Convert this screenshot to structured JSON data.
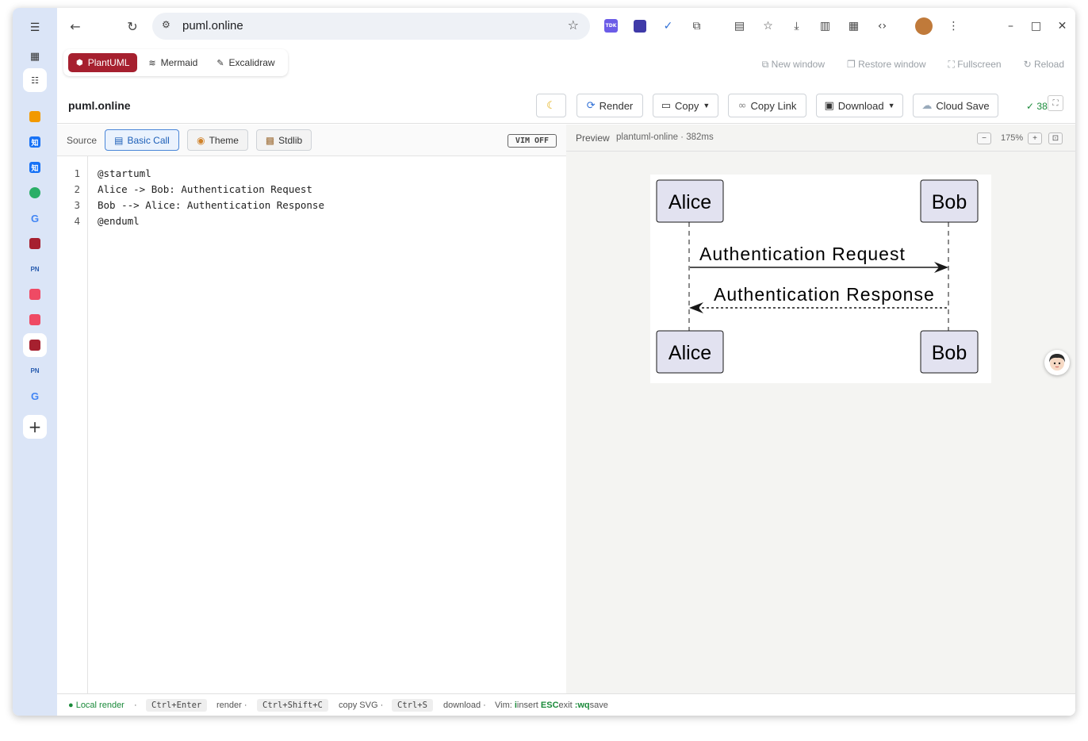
{
  "browser": {
    "url": "puml.online",
    "back_icon": "arrow-left-icon",
    "reload_icon": "reload-icon"
  },
  "modes": [
    {
      "label": "PlantUML",
      "icon": "plantuml-icon",
      "active": true
    },
    {
      "label": "Mermaid",
      "icon": "mermaid-icon",
      "active": false
    },
    {
      "label": "Excalidraw",
      "icon": "edit-icon",
      "active": false
    }
  ],
  "window_controls": {
    "new_window": "New window",
    "restore_window": "Restore window",
    "fullscreen": "Fullscreen",
    "reload": "Reload"
  },
  "header": {
    "title": "puml.online",
    "render": "Render",
    "copy": "Copy",
    "copy_link": "Copy Link",
    "download": "Download",
    "cloud_save": "Cloud Save",
    "status": "✓ 38"
  },
  "source": {
    "label": "Source",
    "basic_call": "Basic Call",
    "theme": "Theme",
    "stdlib": "Stdlib",
    "vim": "VIM OFF"
  },
  "editor": {
    "lines": [
      {
        "n": "1",
        "text": "@startuml"
      },
      {
        "n": "2",
        "text": "Alice -> Bob: Authentication Request"
      },
      {
        "n": "3",
        "text": "Bob --> Alice: Authentication Response"
      },
      {
        "n": "4",
        "text": "@enduml"
      }
    ]
  },
  "preview": {
    "label": "Preview",
    "info": "plantuml-online · 382ms",
    "zoom": "175%",
    "minus": "−",
    "plus": "+"
  },
  "diagram": {
    "participants": [
      "Alice",
      "Bob"
    ],
    "messages": [
      {
        "from": "Alice",
        "to": "Bob",
        "text": "Authentication Request",
        "style": "solid"
      },
      {
        "from": "Bob",
        "to": "Alice",
        "text": "Authentication Response",
        "style": "dashed"
      }
    ]
  },
  "statusbar": {
    "local_render": "● Local render",
    "sep": "·",
    "k1": "Ctrl+Enter",
    "t1": "render ·",
    "k2": "Ctrl+Shift+C",
    "t2": "copy SVG ·",
    "k3": "Ctrl+S",
    "t3": "download ·",
    "vim_prefix": "Vim: ",
    "vim_i": "i",
    "vim_insert": "insert ",
    "vim_esc": "ESC",
    "vim_exit": "exit ",
    "vim_wq": ":wq",
    "vim_save": "save"
  },
  "colors": {
    "accent": "#a6202f",
    "sidebar": "#dbe5f7",
    "participant_fill": "#e2e2f0"
  }
}
